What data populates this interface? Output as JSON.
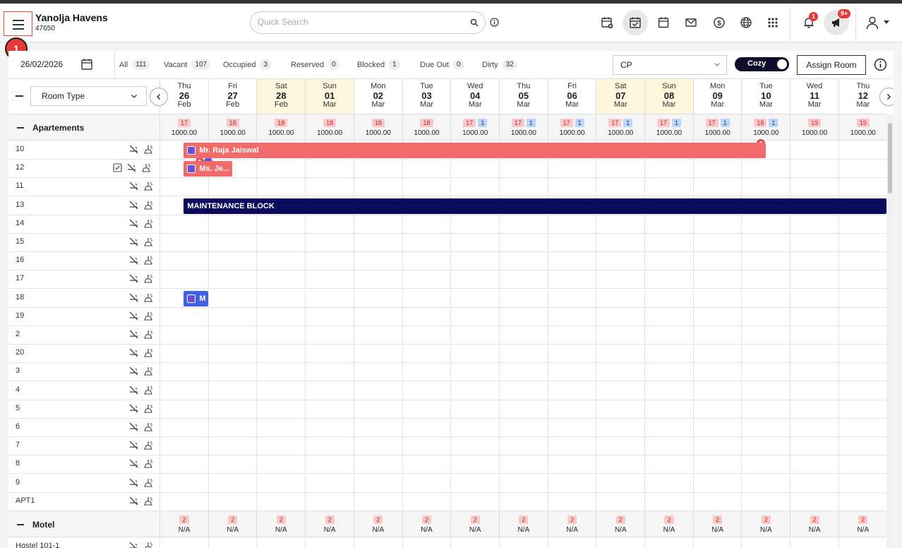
{
  "hotel": {
    "name": "Yanolja Havens",
    "id": "47650"
  },
  "search": {
    "placeholder": "Quick Search"
  },
  "notifications": {
    "bell_count": "1",
    "announce_count": "9+"
  },
  "step_marker": "1",
  "toolbar": {
    "date": "26/02/2026",
    "stats": [
      {
        "label": "All",
        "count": "111"
      },
      {
        "label": "Vacant",
        "count": "107"
      },
      {
        "label": "Occupied",
        "count": "3"
      },
      {
        "label": "Reserved",
        "count": "0"
      },
      {
        "label": "Blocked",
        "count": "1"
      },
      {
        "label": "Due Out",
        "count": "0"
      },
      {
        "label": "Dirty",
        "count": "32"
      }
    ],
    "rate_plan": "CP",
    "view_toggle": "Cozy",
    "assign_room": "Assign Room"
  },
  "grid": {
    "room_type_select": "Room Type",
    "days": [
      {
        "dow": "Thu",
        "num": "26",
        "mon": "Feb",
        "weekend": false
      },
      {
        "dow": "Fri",
        "num": "27",
        "mon": "Feb",
        "weekend": false
      },
      {
        "dow": "Sat",
        "num": "28",
        "mon": "Feb",
        "weekend": true
      },
      {
        "dow": "Sun",
        "num": "01",
        "mon": "Mar",
        "weekend": true
      },
      {
        "dow": "Mon",
        "num": "02",
        "mon": "Mar",
        "weekend": false
      },
      {
        "dow": "Tue",
        "num": "03",
        "mon": "Mar",
        "weekend": false
      },
      {
        "dow": "Wed",
        "num": "04",
        "mon": "Mar",
        "weekend": false
      },
      {
        "dow": "Thu",
        "num": "05",
        "mon": "Mar",
        "weekend": false
      },
      {
        "dow": "Fri",
        "num": "06",
        "mon": "Mar",
        "weekend": false
      },
      {
        "dow": "Sat",
        "num": "07",
        "mon": "Mar",
        "weekend": true
      },
      {
        "dow": "Sun",
        "num": "08",
        "mon": "Mar",
        "weekend": true
      },
      {
        "dow": "Mon",
        "num": "09",
        "mon": "Mar",
        "weekend": false
      },
      {
        "dow": "Tue",
        "num": "10",
        "mon": "Mar",
        "weekend": false
      },
      {
        "dow": "Wed",
        "num": "11",
        "mon": "Mar",
        "weekend": false
      },
      {
        "dow": "Thu",
        "num": "12",
        "mon": "Mar",
        "weekend": false
      }
    ],
    "categories": [
      {
        "name": "Apartements",
        "cells": [
          {
            "avail": "17",
            "blocked": "",
            "rate": "1000.00"
          },
          {
            "avail": "18",
            "blocked": "",
            "rate": "1000.00"
          },
          {
            "avail": "18",
            "blocked": "",
            "rate": "1000.00"
          },
          {
            "avail": "18",
            "blocked": "",
            "rate": "1000.00"
          },
          {
            "avail": "18",
            "blocked": "",
            "rate": "1000.00"
          },
          {
            "avail": "18",
            "blocked": "",
            "rate": "1000.00"
          },
          {
            "avail": "17",
            "blocked": "1",
            "rate": "1000.00"
          },
          {
            "avail": "17",
            "blocked": "1",
            "rate": "1000.00"
          },
          {
            "avail": "17",
            "blocked": "1",
            "rate": "1000.00"
          },
          {
            "avail": "17",
            "blocked": "1",
            "rate": "1000.00"
          },
          {
            "avail": "17",
            "blocked": "1",
            "rate": "1000.00"
          },
          {
            "avail": "17",
            "blocked": "1",
            "rate": "1000.00"
          },
          {
            "avail": "18",
            "blocked": "1",
            "rate": "1000.00"
          },
          {
            "avail": "19",
            "blocked": "",
            "rate": "1000.00"
          },
          {
            "avail": "19",
            "blocked": "",
            "rate": "1000.00"
          }
        ],
        "rooms": [
          {
            "name": "10",
            "checked": false
          },
          {
            "name": "12",
            "checked": true
          },
          {
            "name": "11",
            "checked": false
          },
          {
            "name": "13",
            "checked": false
          },
          {
            "name": "14",
            "checked": false
          },
          {
            "name": "15",
            "checked": false
          },
          {
            "name": "16",
            "checked": false
          },
          {
            "name": "17",
            "checked": false
          },
          {
            "name": "18",
            "checked": false
          },
          {
            "name": "19",
            "checked": false
          },
          {
            "name": "2",
            "checked": false
          },
          {
            "name": "20",
            "checked": false
          },
          {
            "name": "3",
            "checked": false
          },
          {
            "name": "4",
            "checked": false
          },
          {
            "name": "5",
            "checked": false
          },
          {
            "name": "6",
            "checked": false
          },
          {
            "name": "7",
            "checked": false
          },
          {
            "name": "8",
            "checked": false
          },
          {
            "name": "9",
            "checked": false
          },
          {
            "name": "APT1",
            "checked": false
          }
        ]
      },
      {
        "name": "Motel",
        "cells": [
          {
            "avail": "2",
            "blocked": "",
            "rate": "N/A"
          },
          {
            "avail": "2",
            "blocked": "",
            "rate": "N/A"
          },
          {
            "avail": "2",
            "blocked": "",
            "rate": "N/A"
          },
          {
            "avail": "2",
            "blocked": "",
            "rate": "N/A"
          },
          {
            "avail": "2",
            "blocked": "",
            "rate": "N/A"
          },
          {
            "avail": "2",
            "blocked": "",
            "rate": "N/A"
          },
          {
            "avail": "2",
            "blocked": "",
            "rate": "N/A"
          },
          {
            "avail": "2",
            "blocked": "",
            "rate": "N/A"
          },
          {
            "avail": "2",
            "blocked": "",
            "rate": "N/A"
          },
          {
            "avail": "2",
            "blocked": "",
            "rate": "N/A"
          },
          {
            "avail": "2",
            "blocked": "",
            "rate": "N/A"
          },
          {
            "avail": "2",
            "blocked": "",
            "rate": "N/A"
          },
          {
            "avail": "2",
            "blocked": "",
            "rate": "N/A"
          },
          {
            "avail": "2",
            "blocked": "",
            "rate": "N/A"
          },
          {
            "avail": "2",
            "blocked": "",
            "rate": "N/A"
          }
        ],
        "rooms": [
          {
            "name": "Hostel 101-1",
            "checked": false
          }
        ]
      }
    ],
    "reservations": [
      {
        "label": "Mr. Raja Jaiswal",
        "room": "10",
        "start_day": 0,
        "nights": 12,
        "color": "#f26b6b",
        "kind": "guest"
      },
      {
        "label": "Ms. Je...",
        "room": "12",
        "start_day": 0,
        "nights": 1,
        "color": "#f26b6b",
        "kind": "guest"
      },
      {
        "label": "MAINTENANCE BLOCK",
        "room": "13",
        "start_day": 0,
        "nights": 15,
        "color": "#0b0b5e",
        "kind": "block"
      },
      {
        "label": "M",
        "room": "18",
        "start_day": 0,
        "nights": 0.5,
        "color": "#3d63e0",
        "kind": "guest"
      }
    ]
  }
}
